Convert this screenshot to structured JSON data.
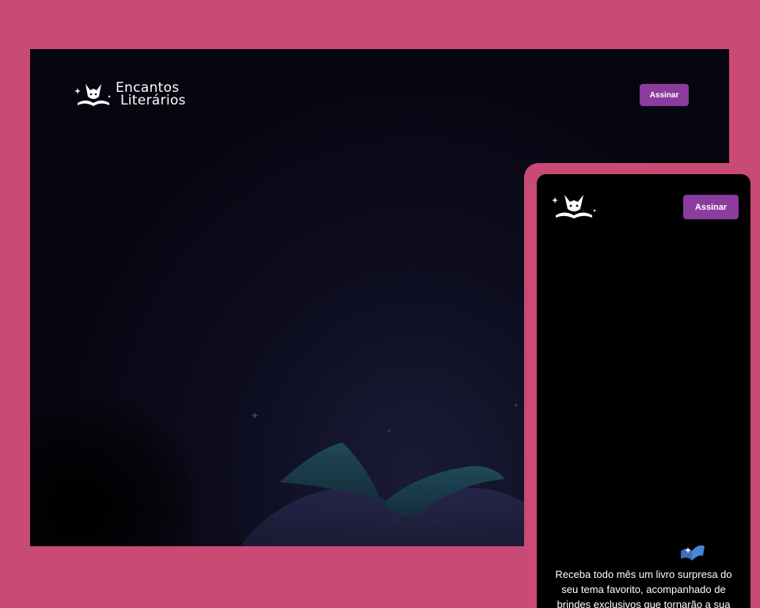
{
  "desktop": {
    "brand": {
      "line1": "Encantos",
      "line2": "Literários"
    },
    "subscribe_label": "Assinar"
  },
  "mobile": {
    "subscribe_label": "Assinar",
    "description": "Receba todo mês um livro surpresa do seu tema favorito, acompanhado de brindes exclusivos que tornarão a sua"
  },
  "colors": {
    "background": "#c94a74",
    "button": "#8c3b9e",
    "screen_dark": "#060611"
  }
}
